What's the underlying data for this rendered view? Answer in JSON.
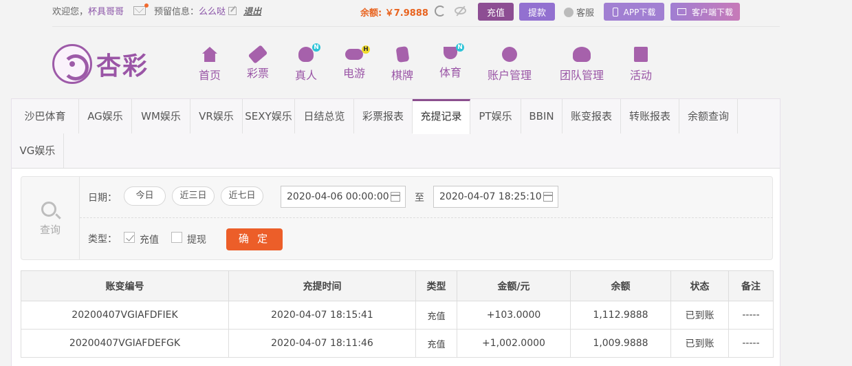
{
  "topbar": {
    "welcome_prefix": "欢迎您，",
    "username": "杯具哥哥",
    "reserved_label": "预留信息：",
    "reserved_value": "么么哒",
    "logout": "退出",
    "balance_label": "余额:",
    "balance_value": "￥7.9888",
    "recharge": "充值",
    "withdraw": "提款",
    "service": "客服",
    "app_download": "APP下载",
    "client_download": "客户端下载"
  },
  "brand": {
    "name": "杏彩"
  },
  "nav": {
    "items": [
      {
        "label": "首页",
        "icon": "home-icon"
      },
      {
        "label": "彩票",
        "icon": "ticket-icon"
      },
      {
        "label": "真人",
        "icon": "live-dealer-icon",
        "badge": "N"
      },
      {
        "label": "电游",
        "icon": "gamepad-icon",
        "badge": "H"
      },
      {
        "label": "棋牌",
        "icon": "cards-icon"
      },
      {
        "label": "体育",
        "icon": "trophy-icon",
        "badge": "N"
      },
      {
        "label": "账户管理",
        "icon": "account-icon"
      },
      {
        "label": "团队管理",
        "icon": "team-icon"
      },
      {
        "label": "活动",
        "icon": "gift-icon"
      }
    ]
  },
  "subtabs": [
    "沙巴体育",
    "AG娱乐",
    "WM娱乐",
    "VR娱乐",
    "SEXY娱乐",
    "日结总览",
    "彩票报表",
    "充提记录",
    "PT娱乐",
    "BBIN",
    "账变报表",
    "转账报表",
    "余额查询",
    "VG娱乐"
  ],
  "active_tab": "充提记录",
  "search": {
    "side_label": "查询",
    "date_label": "日期：",
    "quick": [
      "今日",
      "近三日",
      "近七日"
    ],
    "date_from": "2020-04-06 00:00:00",
    "to_label": "至",
    "date_to": "2020-04-07 18:25:10",
    "type_label": "类型：",
    "type_recharge": "充值",
    "type_withdraw": "提现",
    "type_recharge_checked": true,
    "type_withdraw_checked": false,
    "confirm": "确 定"
  },
  "table": {
    "headers": [
      "账变编号",
      "充提时间",
      "类型",
      "金额/元",
      "余额",
      "状态",
      "备注"
    ],
    "rows": [
      [
        "20200407VGIAFDFIEK",
        "2020-04-07 18:15:41",
        "充值",
        "+103.0000",
        "1,112.9888",
        "已到账",
        "-----"
      ],
      [
        "20200407VGIAFDEFGK",
        "2020-04-07 18:11:46",
        "充值",
        "+1,002.0000",
        "1,009.9888",
        "已到账",
        "-----"
      ]
    ]
  },
  "colors": {
    "brand_purple": "#9a55a6",
    "tab_active_border": "#8b4f8e",
    "balance_orange": "#e8631f",
    "confirm_orange": "#ec5e29",
    "amount_red": "#d12b1f",
    "status_green": "#2a9c3f"
  }
}
